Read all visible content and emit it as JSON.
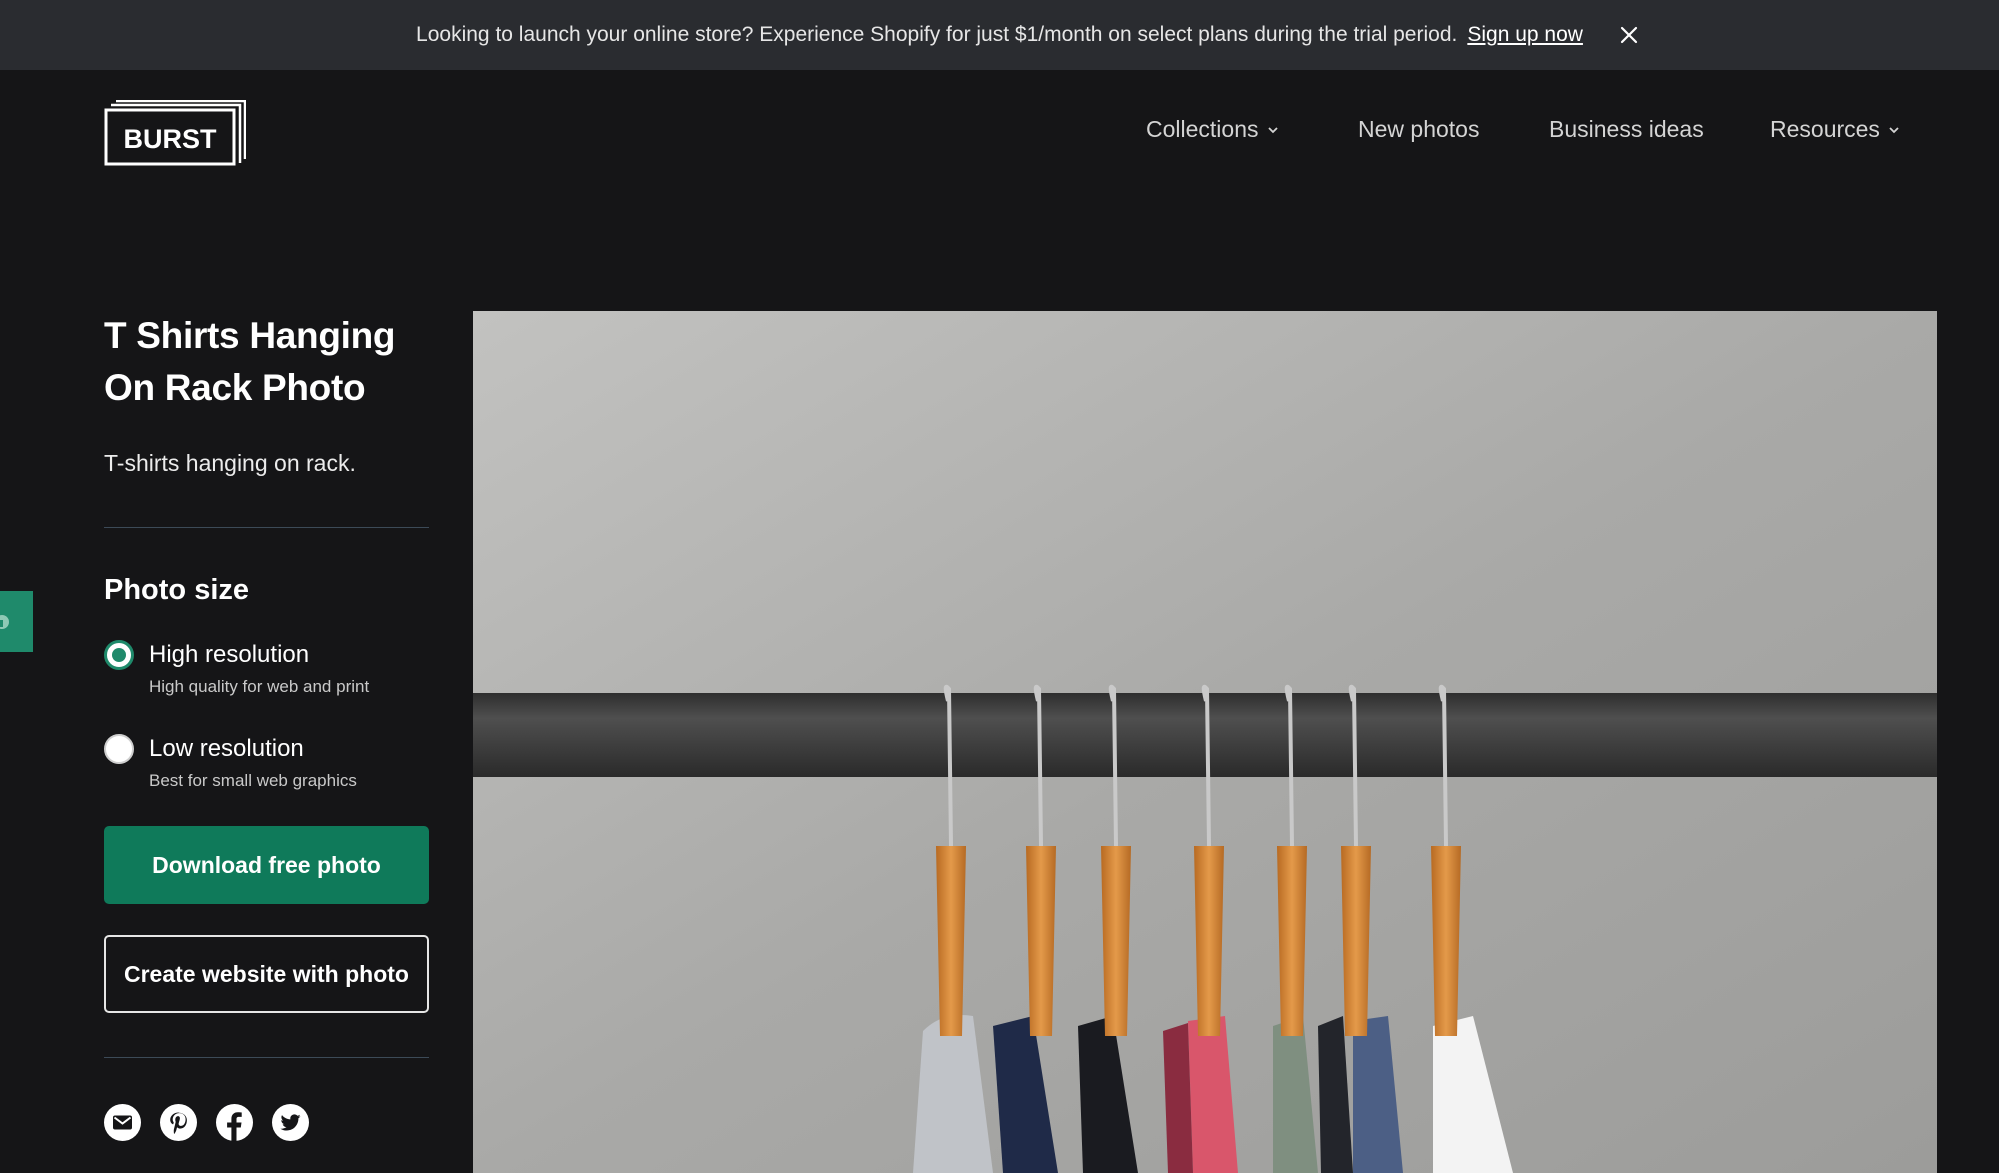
{
  "announcement": {
    "message": "Looking to launch your online store? Experience Shopify for just $1/month on select plans during the trial period.",
    "cta": "Sign up now",
    "close_icon": "close-icon"
  },
  "brand": {
    "logo_text": "BURST"
  },
  "nav": {
    "items": [
      {
        "label": "Collections",
        "has_dropdown": true
      },
      {
        "label": "New photos",
        "has_dropdown": false
      },
      {
        "label": "Business ideas",
        "has_dropdown": false
      },
      {
        "label": "Resources",
        "has_dropdown": true
      }
    ]
  },
  "photo": {
    "title": "T Shirts Hanging On Rack Photo",
    "description": "T-shirts hanging on rack."
  },
  "size_options": {
    "heading": "Photo size",
    "options": [
      {
        "label": "High resolution",
        "hint": "High quality for web and print",
        "selected": true
      },
      {
        "label": "Low resolution",
        "hint": "Best for small web graphics",
        "selected": false
      }
    ]
  },
  "actions": {
    "download": "Download free photo",
    "create_site": "Create website with photo"
  },
  "share": {
    "icons": [
      "email-icon",
      "pinterest-icon",
      "facebook-icon",
      "twitter-icon"
    ]
  },
  "colors": {
    "accent": "#0f7a5a",
    "background": "#151517",
    "announcement_bg": "#2a2c30"
  }
}
